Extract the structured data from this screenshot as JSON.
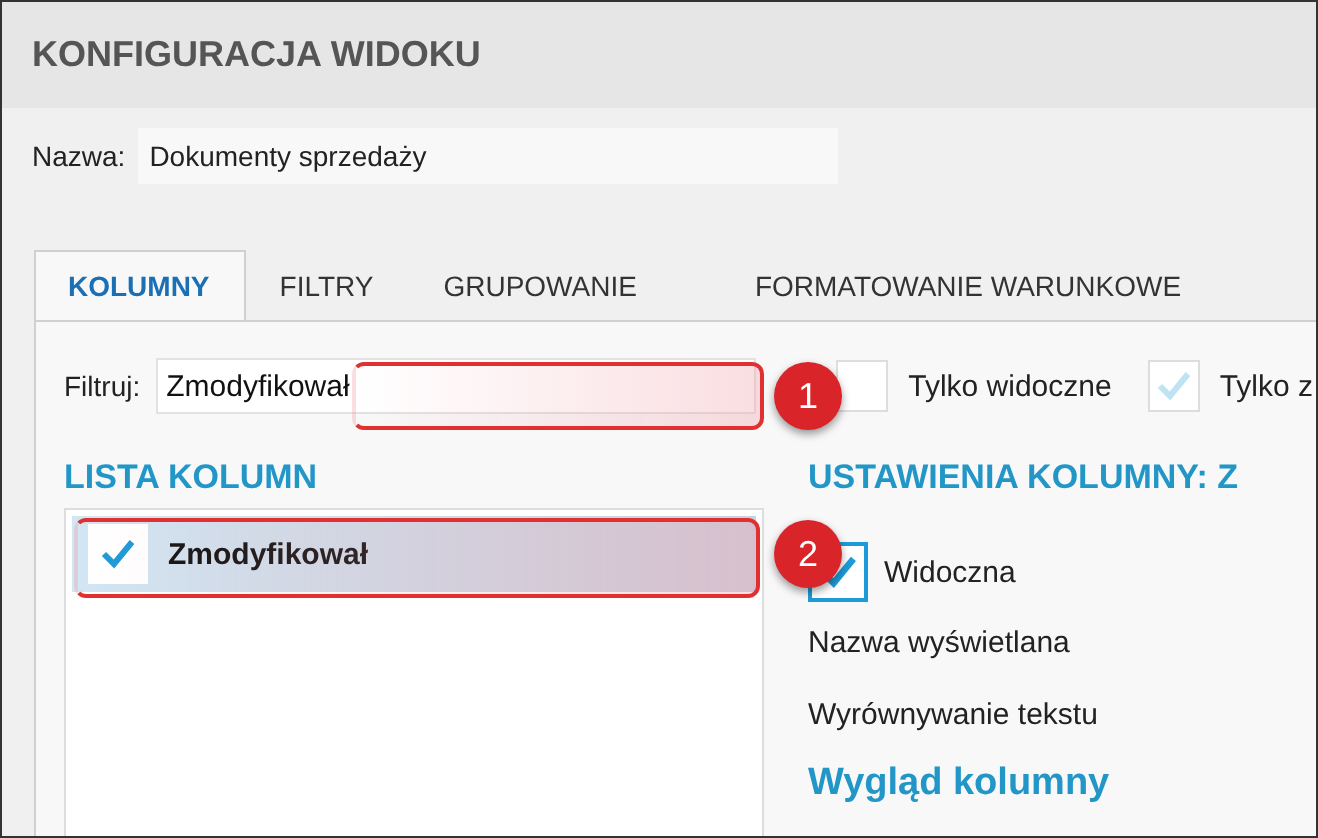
{
  "window": {
    "title": "KONFIGURACJA WIDOKU"
  },
  "name_field": {
    "label": "Nazwa:",
    "value": "Dokumenty sprzedaży"
  },
  "tabs": [
    {
      "label": "KOLUMNY",
      "selected": true
    },
    {
      "label": "FILTRY",
      "selected": false
    },
    {
      "label": "GRUPOWANIE",
      "selected": false
    },
    {
      "label": "FORMATOWANIE WARUNKOWE",
      "selected": false
    }
  ],
  "filter": {
    "label": "Filtruj:",
    "value": "Zmodyfikował"
  },
  "filter_options": [
    {
      "label": "Tylko widoczne",
      "checked": false
    },
    {
      "label": "Tylko z",
      "checked": true
    }
  ],
  "column_list": {
    "title": "LISTA KOLUMN",
    "items": [
      {
        "label": "Zmodyfikował",
        "checked": true,
        "selected": true
      }
    ]
  },
  "column_settings": {
    "title": "USTAWIENIA KOLUMNY: Z",
    "visible": {
      "label": "Widoczna",
      "checked": true
    },
    "fields": [
      {
        "label": "Nazwa wyświetlana"
      },
      {
        "label": "Wyrównywanie tekstu"
      }
    ],
    "section_title": "Wygląd kolumny"
  },
  "callouts": [
    {
      "number": "1"
    },
    {
      "number": "2"
    }
  ]
}
